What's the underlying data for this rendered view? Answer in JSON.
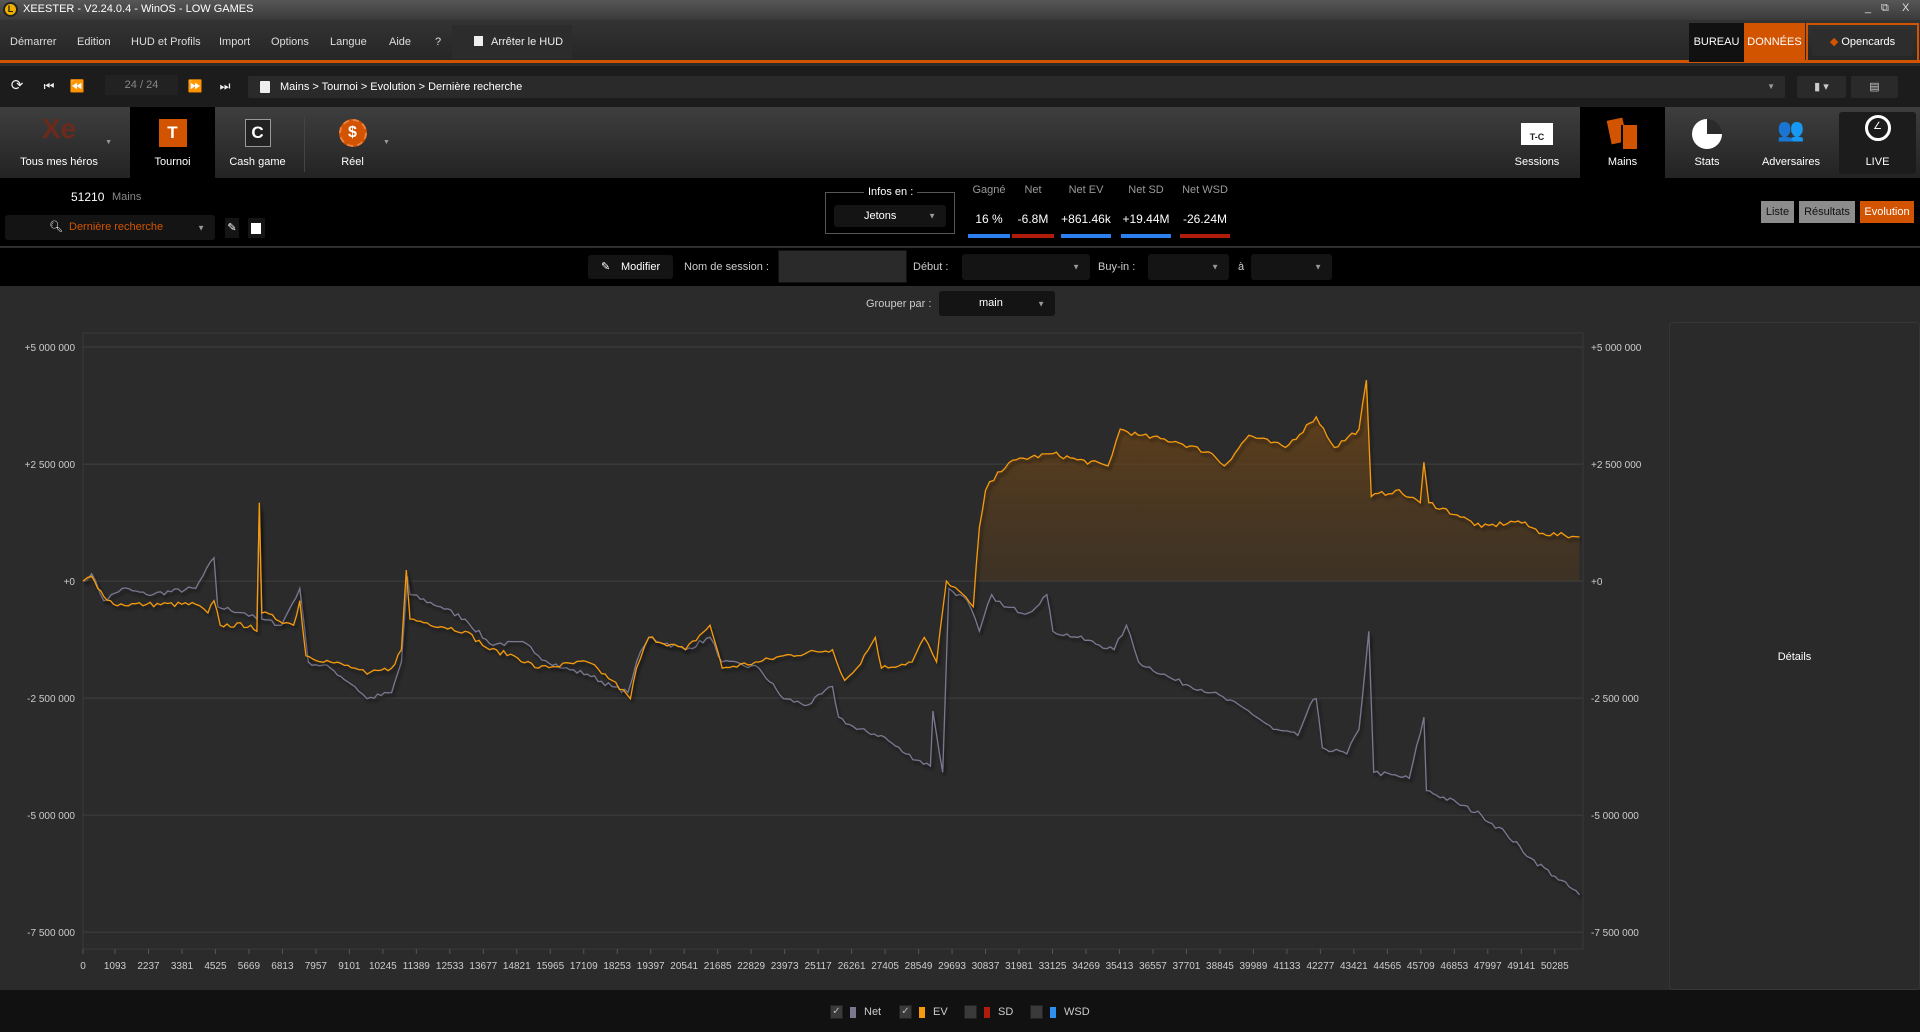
{
  "window": {
    "title": "XEESTER - V2.24.0.4 - WinOS - LOW GAMES",
    "logo": "L",
    "minimize": "_",
    "restore": "⧉",
    "close": "X"
  },
  "menu": {
    "items": [
      "Démarrer",
      "Edition",
      "HUD et Profils",
      "Import",
      "Options",
      "Langue",
      "Aide",
      "?"
    ],
    "hud_toggle": "Arrêter le HUD",
    "bureau": "BUREAU",
    "donnees": "DONNÉES",
    "opencards": "Opencards"
  },
  "nav": {
    "counter": "24 / 24",
    "breadcrumb": "Mains > Tournoi > Evolution > Dernière recherche"
  },
  "toolbar": {
    "left": [
      {
        "label": "Tous mes héros"
      },
      {
        "label": "Tournoi",
        "icon": "T"
      },
      {
        "label": "Cash game",
        "icon": "C"
      },
      {
        "label": "Réel",
        "icon": "$"
      }
    ],
    "right": [
      {
        "label": "Sessions",
        "icon": "T-C"
      },
      {
        "label": "Mains"
      },
      {
        "label": "Stats"
      },
      {
        "label": "Adversaires"
      },
      {
        "label": "LIVE"
      }
    ]
  },
  "info": {
    "hands_count": "51210",
    "hands_label": "Mains",
    "search": "Dernière recherche",
    "infos_en_label": "Infos en :",
    "infos_en_value": "Jetons",
    "stats": [
      {
        "label": "Gagné",
        "value": "16 %",
        "color": "#2d7ff0"
      },
      {
        "label": "Net",
        "value": "-6.8M",
        "color": "#b01c0c"
      },
      {
        "label": "Net EV",
        "value": "+861.46k",
        "color": "#2d7ff0"
      },
      {
        "label": "Net SD",
        "value": "+19.44M",
        "color": "#2d7ff0"
      },
      {
        "label": "Net WSD",
        "value": "-26.24M",
        "color": "#b01c0c"
      }
    ],
    "views": [
      "Liste",
      "Résultats",
      "Evolution"
    ],
    "active_view": "Evolution"
  },
  "filters": {
    "modifier": "Modifier",
    "session_label": "Nom de session :",
    "session_value": "",
    "debut_label": "Début :",
    "buyin_label": "Buy-in :",
    "a_label": "à",
    "group_label": "Grouper par :",
    "group_value": "main"
  },
  "details": "Détails",
  "colors": {
    "accent": "#d35400",
    "net": "#7a7890",
    "ev": "#f59a0c",
    "sd": "#b01c0c",
    "wsd": "#2d8ff0"
  },
  "chart_data": {
    "type": "line",
    "xlabel": "Mains",
    "ylabel": "Jetons",
    "xlim": [
      0,
      51250
    ],
    "ylim": [
      -7860000,
      5300000
    ],
    "yticks": [
      5000000,
      2500000,
      0,
      -2500000,
      -5000000,
      -7500000
    ],
    "ytick_labels": [
      "+5 000 000",
      "+2 500 000",
      "+0",
      "-2 500 000",
      "-5 000 000",
      "-7 500 000"
    ],
    "xticks": [
      0,
      1093,
      2237,
      3381,
      4525,
      5669,
      6813,
      7957,
      9101,
      10245,
      11389,
      12533,
      13677,
      14821,
      15965,
      17109,
      18253,
      19397,
      20541,
      21685,
      22829,
      23973,
      25117,
      26261,
      27405,
      28549,
      29693,
      30837,
      31981,
      33125,
      34269,
      35413,
      36557,
      37701,
      38845,
      39989,
      41133,
      42277,
      43421,
      44565,
      45709,
      46853,
      47997,
      49141,
      50285
    ],
    "grid": true,
    "legend": [
      {
        "name": "Net",
        "checked": true
      },
      {
        "name": "EV",
        "checked": true
      },
      {
        "name": "SD",
        "checked": false
      },
      {
        "name": "WSD",
        "checked": false
      }
    ],
    "series": [
      {
        "name": "Net",
        "points": [
          [
            0,
            0
          ],
          [
            293,
            157
          ],
          [
            711,
            -419
          ],
          [
            1339,
            -157
          ],
          [
            2176,
            -288
          ],
          [
            3849,
            -157
          ],
          [
            4477,
            497
          ],
          [
            4602,
            -550
          ],
          [
            5523,
            -681
          ],
          [
            5941,
            -812
          ],
          [
            6025,
            1544
          ],
          [
            6109,
            -812
          ],
          [
            6778,
            -942
          ],
          [
            7406,
            -157
          ],
          [
            7699,
            -1728
          ],
          [
            8452,
            -1859
          ],
          [
            9288,
            -2252
          ],
          [
            9707,
            -2513
          ],
          [
            10544,
            -2383
          ],
          [
            10878,
            -1728
          ],
          [
            11088,
            105
          ],
          [
            11171,
            -288
          ],
          [
            12217,
            -550
          ],
          [
            13054,
            -812
          ],
          [
            13891,
            -1335
          ],
          [
            15146,
            -1335
          ],
          [
            15564,
            -1597
          ],
          [
            16401,
            -1859
          ],
          [
            17238,
            -1990
          ],
          [
            18075,
            -2252
          ],
          [
            18619,
            -2383
          ],
          [
            18912,
            -1728
          ],
          [
            19331,
            -1204
          ],
          [
            20586,
            -1466
          ],
          [
            21422,
            -1204
          ],
          [
            21841,
            -1728
          ],
          [
            23096,
            -1859
          ],
          [
            23933,
            -2513
          ],
          [
            24770,
            -2645
          ],
          [
            25607,
            -2252
          ],
          [
            25816,
            -2906
          ],
          [
            26443,
            -3168
          ],
          [
            27280,
            -3299
          ],
          [
            28117,
            -3691
          ],
          [
            28954,
            -3953
          ],
          [
            29038,
            -2776
          ],
          [
            29373,
            -4084
          ],
          [
            29582,
            -157
          ],
          [
            30209,
            -419
          ],
          [
            30627,
            -1073
          ],
          [
            31046,
            -288
          ],
          [
            31464,
            -550
          ],
          [
            32301,
            -681
          ],
          [
            32929,
            -288
          ],
          [
            33138,
            -1073
          ],
          [
            33975,
            -1204
          ],
          [
            35230,
            -1466
          ],
          [
            35648,
            -942
          ],
          [
            36067,
            -1728
          ],
          [
            37322,
            -2121
          ],
          [
            38577,
            -2383
          ],
          [
            39832,
            -2776
          ],
          [
            40669,
            -3168
          ],
          [
            41506,
            -3299
          ],
          [
            41924,
            -2645
          ],
          [
            42133,
            -2513
          ],
          [
            42343,
            -3560
          ],
          [
            43180,
            -3691
          ],
          [
            43597,
            -3168
          ],
          [
            43932,
            -1073
          ],
          [
            44100,
            -4084
          ],
          [
            45313,
            -4215
          ],
          [
            45815,
            -2906
          ],
          [
            45899,
            -4477
          ],
          [
            46945,
            -4738
          ],
          [
            47782,
            -5000
          ],
          [
            48619,
            -5393
          ],
          [
            49456,
            -5916
          ],
          [
            50292,
            -6309
          ],
          [
            51129,
            -6702
          ]
        ]
      },
      {
        "name": "EV",
        "points": [
          [
            0,
            0
          ],
          [
            293,
            105
          ],
          [
            502,
            -157
          ],
          [
            1046,
            -497
          ],
          [
            2176,
            -497
          ],
          [
            3849,
            -497
          ],
          [
            4268,
            -681
          ],
          [
            4477,
            -419
          ],
          [
            4686,
            -942
          ],
          [
            5732,
            -942
          ],
          [
            5941,
            -1073
          ],
          [
            6025,
            1675
          ],
          [
            6109,
            -681
          ],
          [
            7196,
            -942
          ],
          [
            7406,
            -419
          ],
          [
            7615,
            -1597
          ],
          [
            8452,
            -1728
          ],
          [
            9288,
            -1859
          ],
          [
            9707,
            -1990
          ],
          [
            10544,
            -1859
          ],
          [
            10878,
            -1466
          ],
          [
            11046,
            236
          ],
          [
            11171,
            -812
          ],
          [
            13054,
            -1073
          ],
          [
            13891,
            -1466
          ],
          [
            14728,
            -1597
          ],
          [
            15564,
            -1859
          ],
          [
            17238,
            -1728
          ],
          [
            18077,
            -2121
          ],
          [
            18703,
            -2513
          ],
          [
            18912,
            -1859
          ],
          [
            19331,
            -1204
          ],
          [
            20586,
            -1466
          ],
          [
            21422,
            -942
          ],
          [
            21841,
            -1859
          ],
          [
            23096,
            -1728
          ],
          [
            23933,
            -1597
          ],
          [
            25607,
            -1466
          ],
          [
            26025,
            -2121
          ],
          [
            26443,
            -1859
          ],
          [
            27071,
            -1204
          ],
          [
            27280,
            -1859
          ],
          [
            28326,
            -1728
          ],
          [
            28745,
            -1204
          ],
          [
            29163,
            -1728
          ],
          [
            29498,
            0
          ],
          [
            29791,
            -131
          ],
          [
            30418,
            -550
          ],
          [
            30627,
            1152
          ],
          [
            30837,
            1937
          ],
          [
            31255,
            2330
          ],
          [
            31883,
            2592
          ],
          [
            33138,
            2723
          ],
          [
            33975,
            2592
          ],
          [
            35021,
            2461
          ],
          [
            35439,
            3246
          ],
          [
            36067,
            3115
          ],
          [
            37322,
            2984
          ],
          [
            38577,
            2723
          ],
          [
            38995,
            2461
          ],
          [
            39832,
            3115
          ],
          [
            41087,
            2854
          ],
          [
            41924,
            3377
          ],
          [
            42133,
            3508
          ],
          [
            42761,
            2854
          ],
          [
            43597,
            3246
          ],
          [
            43848,
            4293
          ],
          [
            44016,
            1806
          ],
          [
            44852,
            1937
          ],
          [
            45689,
            1675
          ],
          [
            45815,
            2540
          ],
          [
            45982,
            1675
          ],
          [
            46945,
            1414
          ],
          [
            47782,
            1152
          ],
          [
            49037,
            1283
          ],
          [
            49874,
            1021
          ],
          [
            51129,
            942
          ]
        ]
      }
    ],
    "value_unit": "thousands"
  }
}
